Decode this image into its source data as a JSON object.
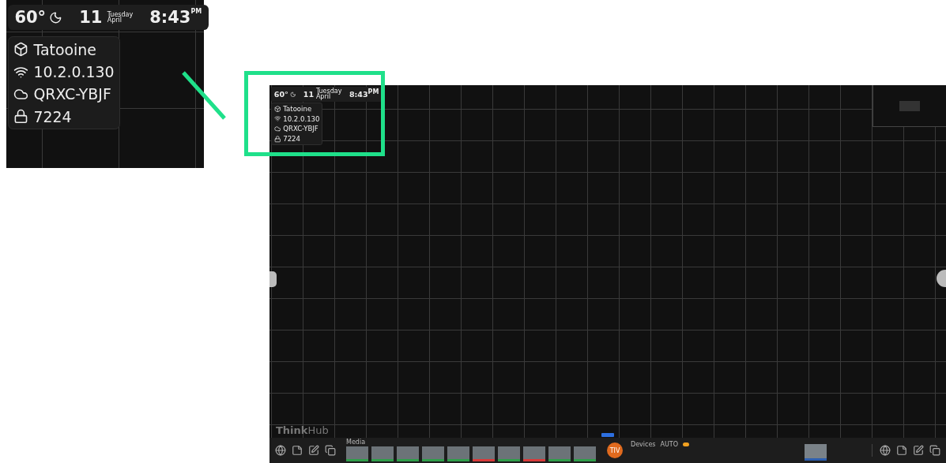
{
  "callout": {
    "status": {
      "temperature": "60°",
      "day": "11",
      "weekday": "Tuesday",
      "month": "April",
      "clock": "8:43",
      "period": "PM"
    },
    "info": [
      {
        "kind": "room",
        "text": "Tatooine"
      },
      {
        "kind": "ip",
        "text": "10.2.0.130"
      },
      {
        "kind": "cloud",
        "text": "QRXC-YBJF"
      },
      {
        "kind": "pin",
        "text": "7224"
      }
    ]
  },
  "screen": {
    "status": {
      "temperature": "60°",
      "day": "11",
      "weekday": "Tuesday",
      "month": "April",
      "clock": "8:43",
      "period": "PM"
    },
    "info": [
      {
        "kind": "room",
        "text": "Tatooine"
      },
      {
        "kind": "ip",
        "text": "10.2.0.130"
      },
      {
        "kind": "cloud",
        "text": "QRXC-YBJF"
      },
      {
        "kind": "pin",
        "text": "7224"
      }
    ],
    "brand": {
      "bold": "Think",
      "light": "Hub"
    },
    "dock": {
      "media_label": "Media",
      "devices_label": "Devices",
      "auto_label": "AUTO",
      "auto_on": true,
      "avatar": "TIV",
      "left_tools": [
        {
          "kind": "globe"
        },
        {
          "kind": "note"
        },
        {
          "kind": "pen"
        },
        {
          "kind": "windows"
        }
      ],
      "thumbnails": [
        {
          "color": "#2f9e4a"
        },
        {
          "color": "#2f9e4a"
        },
        {
          "color": "#2f9e4a"
        },
        {
          "color": "#2f9e4a"
        },
        {
          "color": "#2f9e4a"
        },
        {
          "color": "#d83a3a"
        },
        {
          "color": "#2f9e4a"
        },
        {
          "color": "#d83a3a"
        },
        {
          "color": "#2f9e4a"
        },
        {
          "color": "#2f9e4a"
        }
      ],
      "right_tools": [
        {
          "kind": "globe"
        },
        {
          "kind": "note"
        },
        {
          "kind": "pen"
        },
        {
          "kind": "windows"
        }
      ]
    }
  }
}
